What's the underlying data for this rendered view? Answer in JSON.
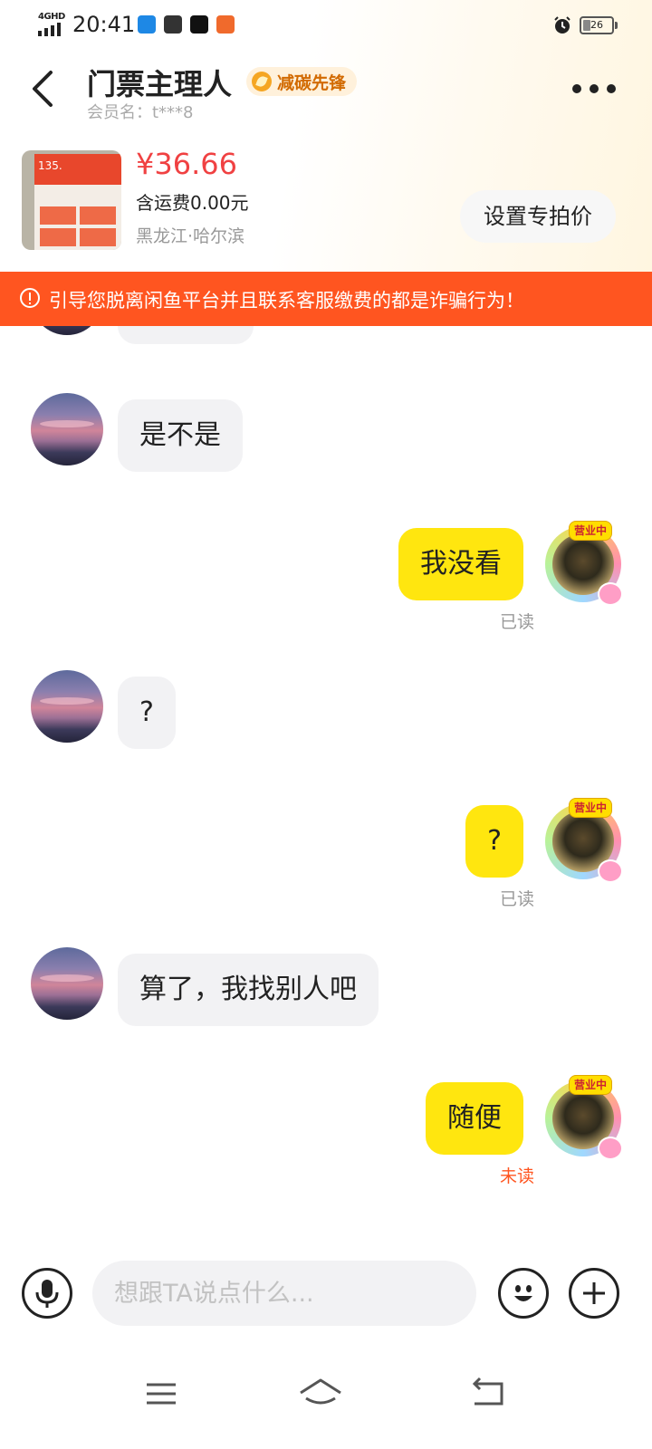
{
  "status_bar": {
    "network": "4GHD",
    "time": "20:41",
    "battery": "26",
    "battery_level_percent": 26
  },
  "header": {
    "title": "门票主理人",
    "badge": "减碳先锋",
    "member": "会员名：t***8"
  },
  "product": {
    "price": "¥36.66",
    "shipping": "含运费0.00元",
    "location": "黑龙江·哈尔滨",
    "thumbnail_text": "135.",
    "set_price_label": "设置专拍价"
  },
  "warning": {
    "text": "引导您脱离闲鱼平台并且联系客服缴费的都是诈骗行为！"
  },
  "messages": [
    {
      "side": "in",
      "text": "是不是"
    },
    {
      "side": "out",
      "text": "我没看",
      "status": "已读"
    },
    {
      "side": "in",
      "text": "?"
    },
    {
      "side": "out",
      "text": "?",
      "status": "已读"
    },
    {
      "side": "in",
      "text": "算了，我找别人吧"
    },
    {
      "side": "out",
      "text": "随便",
      "status": "未读"
    }
  ],
  "avatar_tag": "营业中",
  "input": {
    "placeholder": "想跟TA说点什么..."
  },
  "colors": {
    "accent_red": "#f04142",
    "warning_bg": "#ff5520",
    "bubble_out": "#ffe60f",
    "bubble_in": "#f2f2f4",
    "unread": "#ff5520"
  }
}
